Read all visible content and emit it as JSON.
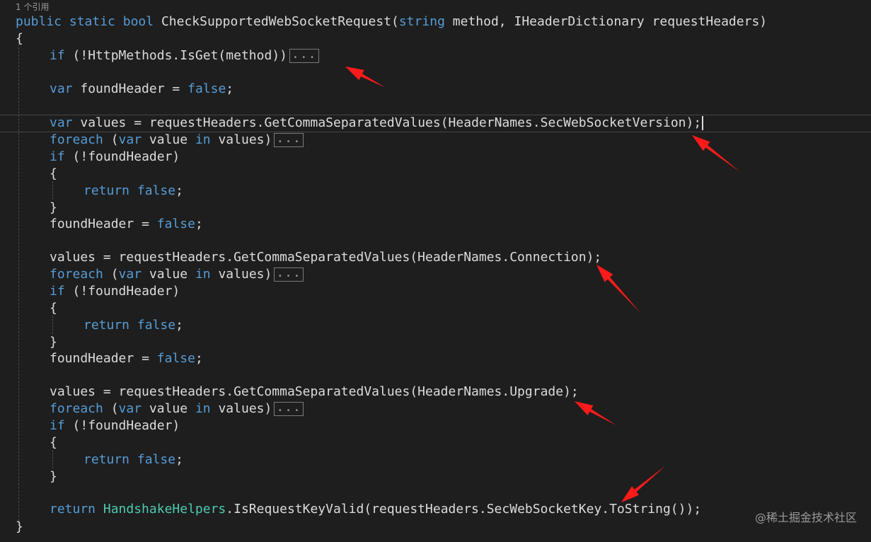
{
  "editor": {
    "codelens": "1 个引用",
    "lines": {
      "sig": {
        "kw_public": "public",
        "kw_static": "static",
        "kw_bool": "bool",
        "method_name": "CheckSupportedWebSocketRequest(",
        "kw_string": "string",
        "param1": "method, IHeaderDictionary",
        "param2": "requestHeaders",
        "close": ")"
      },
      "open_brace": "{",
      "if_get": {
        "kw": "if",
        "rest": "(!HttpMethods.IsGet(",
        "arg": "method",
        "close": "))",
        "fold": "..."
      },
      "found_decl": {
        "kw_var": "var",
        "name": "foundHeader",
        "eq": "=",
        "kw_false": "false",
        "semi": ";"
      },
      "values_decl": {
        "kw_var": "var",
        "name": "values",
        "eq": "=",
        "call": "requestHeaders.GetCommaSeparatedValues(HeaderNames.SecWebSocketVersion);"
      },
      "foreach": {
        "kw_foreach": "foreach",
        "open": "(",
        "kw_var": "var",
        "item": "value",
        "kw_in": "in",
        "coll": "values)",
        "fold": "..."
      },
      "if_found": {
        "kw": "if",
        "rest": "(!foundHeader)"
      },
      "brace_open": "{",
      "ret_false": {
        "kw_return": "return",
        "kw_false": "false",
        "semi": ";"
      },
      "brace_close": "}",
      "found_reset": {
        "name": "foundHeader",
        "eq": "=",
        "kw_false": "false",
        "semi": ";"
      },
      "values_conn": "values = requestHeaders.GetCommaSeparatedValues(HeaderNames.Connection);",
      "values_upgrade": "values = requestHeaders.GetCommaSeparatedValues(HeaderNames.Upgrade);",
      "final_return": {
        "kw_return": "return",
        "cls": "HandshakeHelpers",
        "call": ".IsRequestKeyValid(requestHeaders.SecWebSocketKey.ToString());"
      },
      "close_brace": "}"
    }
  },
  "annotations": {
    "arrow_color": "#ff1a1a",
    "count": 5
  },
  "watermark": "@稀土掘金技术社区",
  "colors": {
    "background": "#1e1e1e",
    "text": "#dcdcdc",
    "keyword": "#569cd6",
    "type": "#4ec9b0"
  }
}
